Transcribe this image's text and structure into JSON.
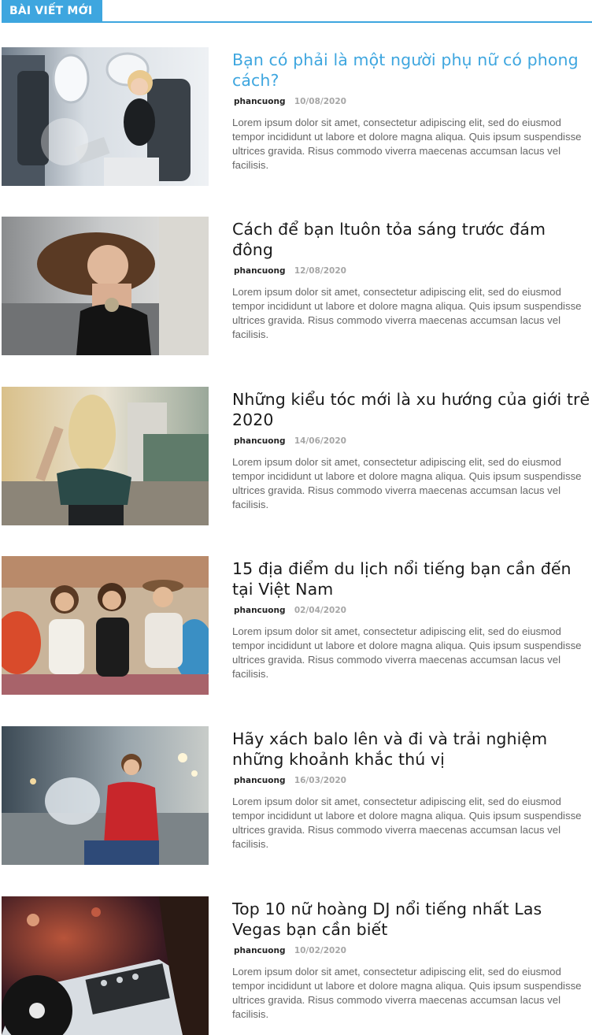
{
  "section": {
    "title": "BÀI VIẾT MỚI"
  },
  "accent_color": "#3ea6df",
  "posts": [
    {
      "title": "Bạn có phải là một người phụ nữ có phong cách?",
      "author": "phancuong",
      "date": "10/08/2020",
      "excerpt": "Lorem ipsum dolor sit amet, consectetur adipiscing elit, sed do eiusmod tempor incididunt ut labore et dolore magna aliqua. Quis ipsum suspendisse ultrices gravida. Risus commodo viverra maecenas accumsan lacus vel facilisis.",
      "image": "woman-with-laptop-on-airplane"
    },
    {
      "title": "Cách để bạn ltuôn tỏa sáng trước đám đông",
      "author": "phancuong",
      "date": "12/08/2020",
      "excerpt": "Lorem ipsum dolor sit amet, consectetur adipiscing elit, sed do eiusmod tempor incididunt ut labore et dolore magna aliqua. Quis ipsum suspendisse ultrices gravida. Risus commodo viverra maecenas accumsan lacus vel facilisis.",
      "image": "smiling-woman-hair-flip"
    },
    {
      "title": "Những kiểu tóc mới là xu hướng của giới trẻ 2020",
      "author": "phancuong",
      "date": "14/06/2020",
      "excerpt": "Lorem ipsum dolor sit amet, consectetur adipiscing elit, sed do eiusmod tempor incididunt ut labore et dolore magna aliqua. Quis ipsum suspendisse ultrices gravida. Risus commodo viverra maecenas accumsan lacus vel facilisis.",
      "image": "blonde-woman-city-street"
    },
    {
      "title": "15 địa điểm du lịch nổi tiếng bạn cần đến tại Việt Nam",
      "author": "phancuong",
      "date": "02/04/2020",
      "excerpt": "Lorem ipsum dolor sit amet, consectetur adipiscing elit, sed do eiusmod tempor incididunt ut labore et dolore magna aliqua. Quis ipsum suspendisse ultrices gravida. Risus commodo viverra maecenas accumsan lacus vel facilisis.",
      "image": "three-women-festival"
    },
    {
      "title": "Hãy xách balo lên và đi và trải nghiệm những khoảnh khắc thú vị",
      "author": "phancuong",
      "date": "16/03/2020",
      "excerpt": "Lorem ipsum dolor sit amet, consectetur adipiscing elit, sed do eiusmod tempor incididunt ut labore et dolore magna aliqua. Quis ipsum suspendisse ultrices gravida. Risus commodo viverra maecenas accumsan lacus vel facilisis.",
      "image": "woman-red-jacket-fountain"
    },
    {
      "title": "Top 10 nữ hoàng DJ nổi tiếng nhất Las Vegas bạn cần biết",
      "author": "phancuong",
      "date": "10/02/2020",
      "excerpt": "Lorem ipsum dolor sit amet, consectetur adipiscing elit, sed do eiusmod tempor incididunt ut labore et dolore magna aliqua. Quis ipsum suspendisse ultrices gravida. Risus commodo viverra maecenas accumsan lacus vel facilisis.",
      "image": "dj-turntable-mixer"
    }
  ]
}
